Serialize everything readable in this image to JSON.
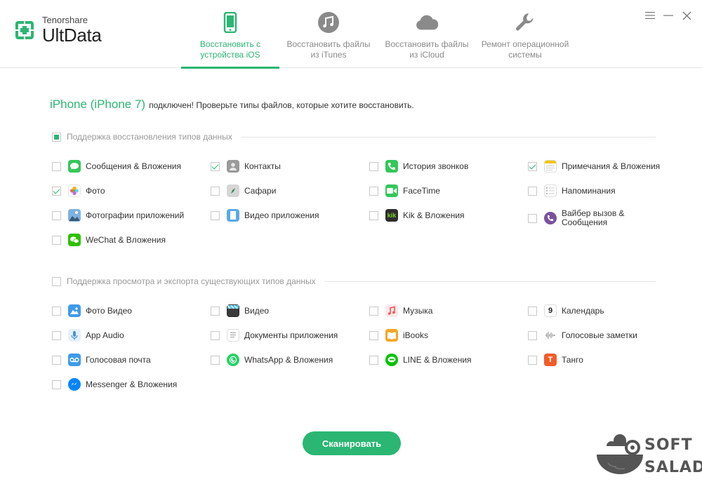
{
  "app": {
    "company": "Tenorshare",
    "product": "UltData",
    "brand_color": "#2bb673"
  },
  "tabs": [
    {
      "label": "Восстановить с устройства iOS",
      "icon": "phone-icon",
      "active": true
    },
    {
      "label": "Восстановить файлы из iTunes",
      "icon": "music-icon",
      "active": false
    },
    {
      "label": "Восстановить файлы из iCloud",
      "icon": "cloud-icon",
      "active": false
    },
    {
      "label": "Ремонт операционной системы",
      "icon": "wrench-icon",
      "active": false
    }
  ],
  "status": {
    "device": "iPhone (iPhone 7)",
    "message": "подключен! Проверьте типы файлов, которые хотите восстановить."
  },
  "section_recover": {
    "title": "Поддержка восстановления типов данных",
    "state": "partial",
    "items": [
      {
        "label": "Сообщения & Вложения",
        "icon": "messages-icon",
        "checked": false
      },
      {
        "label": "Контакты",
        "icon": "contacts-icon",
        "checked": true
      },
      {
        "label": "История звонков",
        "icon": "phone-call-icon",
        "checked": false
      },
      {
        "label": "Примечания & Вложения",
        "icon": "notes-icon",
        "checked": true
      },
      {
        "label": "Фото",
        "icon": "photos-icon",
        "checked": true
      },
      {
        "label": "Сафари",
        "icon": "safari-icon",
        "checked": false
      },
      {
        "label": "FaceTime",
        "icon": "facetime-icon",
        "checked": false
      },
      {
        "label": "Напоминания",
        "icon": "reminders-icon",
        "checked": false
      },
      {
        "label": "Фотографии приложений",
        "icon": "app-photos-icon",
        "checked": false
      },
      {
        "label": "Видео приложения",
        "icon": "app-video-icon",
        "checked": false
      },
      {
        "label": "Kik & Вложения",
        "icon": "kik-icon",
        "checked": false
      },
      {
        "label": "Вайбер вызов & Сообщения",
        "icon": "viber-icon",
        "checked": false
      },
      {
        "label": "WeChat & Вложения",
        "icon": "wechat-icon",
        "checked": false
      }
    ]
  },
  "section_export": {
    "title": "Поддержка просмотра и экспорта существующих типов данных",
    "state": "unchecked",
    "items": [
      {
        "label": "Фото Видео",
        "icon": "photo-video-icon",
        "checked": false
      },
      {
        "label": "Видео",
        "icon": "video-icon",
        "checked": false
      },
      {
        "label": "Музыка",
        "icon": "music-note-icon",
        "checked": false
      },
      {
        "label": "Календарь",
        "icon": "calendar-icon",
        "checked": false
      },
      {
        "label": "App Audio",
        "icon": "app-audio-icon",
        "checked": false
      },
      {
        "label": "Документы приложения",
        "icon": "documents-icon",
        "checked": false
      },
      {
        "label": "iBooks",
        "icon": "ibooks-icon",
        "checked": false
      },
      {
        "label": "Голосовые заметки",
        "icon": "voice-memos-icon",
        "checked": false
      },
      {
        "label": "Голосовая почта",
        "icon": "voicemail-icon",
        "checked": false
      },
      {
        "label": "WhatsApp & Вложения",
        "icon": "whatsapp-icon",
        "checked": false
      },
      {
        "label": "LINE & Вложения",
        "icon": "line-icon",
        "checked": false
      },
      {
        "label": "Танго",
        "icon": "tango-icon",
        "checked": false
      },
      {
        "label": "Messenger & Вложения",
        "icon": "messenger-icon",
        "checked": false
      }
    ]
  },
  "calendar_day": "9",
  "scan_button": "Сканировать",
  "watermark": {
    "line1": "SOFT",
    "line2": "SALAD"
  }
}
